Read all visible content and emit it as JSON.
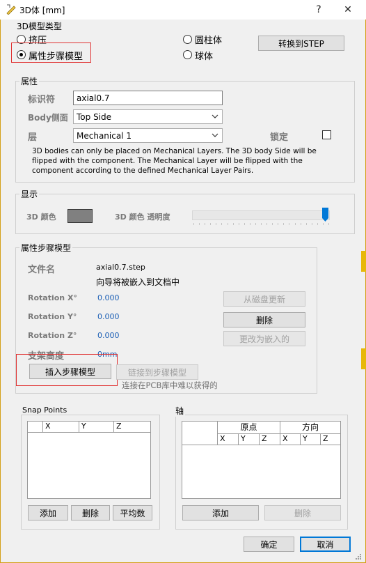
{
  "window": {
    "title": "3D体 [mm]",
    "help_label": "?",
    "close_label": "✕"
  },
  "model_type": {
    "group_title": "3D模型类型",
    "extrude_label": "挤压",
    "step_model_label": "属性步骤模型",
    "cylinder_label": "圆柱体",
    "sphere_label": "球体",
    "convert_step_label": "转换到STEP",
    "selected": "step_model"
  },
  "properties": {
    "group_title": "属性",
    "identifier_label": "标识符",
    "identifier_value": "axial0.7",
    "body_side_label": "Body侧面",
    "body_side_value": "Top Side",
    "layer_label": "层",
    "layer_value": "Mechanical 1",
    "lock_label": "锁定",
    "info_line1": "3D bodies can only be placed on Mechanical Layers. The 3D body Side will be",
    "info_line2": "flipped with the component. The Mechanical Layer will be flipped with the",
    "info_line3": "component according to the defined Mechanical Layer Pairs."
  },
  "display": {
    "group_title": "显示",
    "color_label": "3D 颜色",
    "color_value": "#808080",
    "opacity_label": "3D 颜色 透明度",
    "opacity_fraction": 1.0,
    "slider_color": "#0078d7"
  },
  "step_model": {
    "group_title": "属性步骤模型",
    "filename_label": "文件名",
    "filename_value": "axial0.7.step",
    "embed_note": "向导将被嵌入到文档中",
    "rot_x_label": "Rotation X°",
    "rot_x_value": "0.000",
    "rot_y_label": "Rotation Y°",
    "rot_y_value": "0.000",
    "rot_z_label": "Rotation Z°",
    "rot_z_value": "0.000",
    "standoff_label": "支架高度",
    "standoff_value": "0mm",
    "update_from_disk_label": "从磁盘更新",
    "delete_label": "删除",
    "change_to_embedded_label": "更改为嵌入的",
    "insert_step_label": "插入步骤模型",
    "link_step_label": "链接到步骤模型",
    "link_note": "连接在PCB库中难以获得的"
  },
  "snap_points": {
    "group_title": "Snap Points",
    "columns": [
      "",
      "X",
      "Y",
      "Z"
    ],
    "add_label": "添加",
    "delete_label": "删除",
    "average_label": "平均数"
  },
  "axis": {
    "group_title": "轴",
    "origin_header": "原点",
    "direction_header": "方向",
    "columns": [
      "",
      "X",
      "Y",
      "Z",
      "X",
      "Y",
      "Z"
    ],
    "add_label": "添加",
    "delete_label": "删除"
  },
  "footer": {
    "ok_label": "确定",
    "cancel_label": "取消"
  }
}
